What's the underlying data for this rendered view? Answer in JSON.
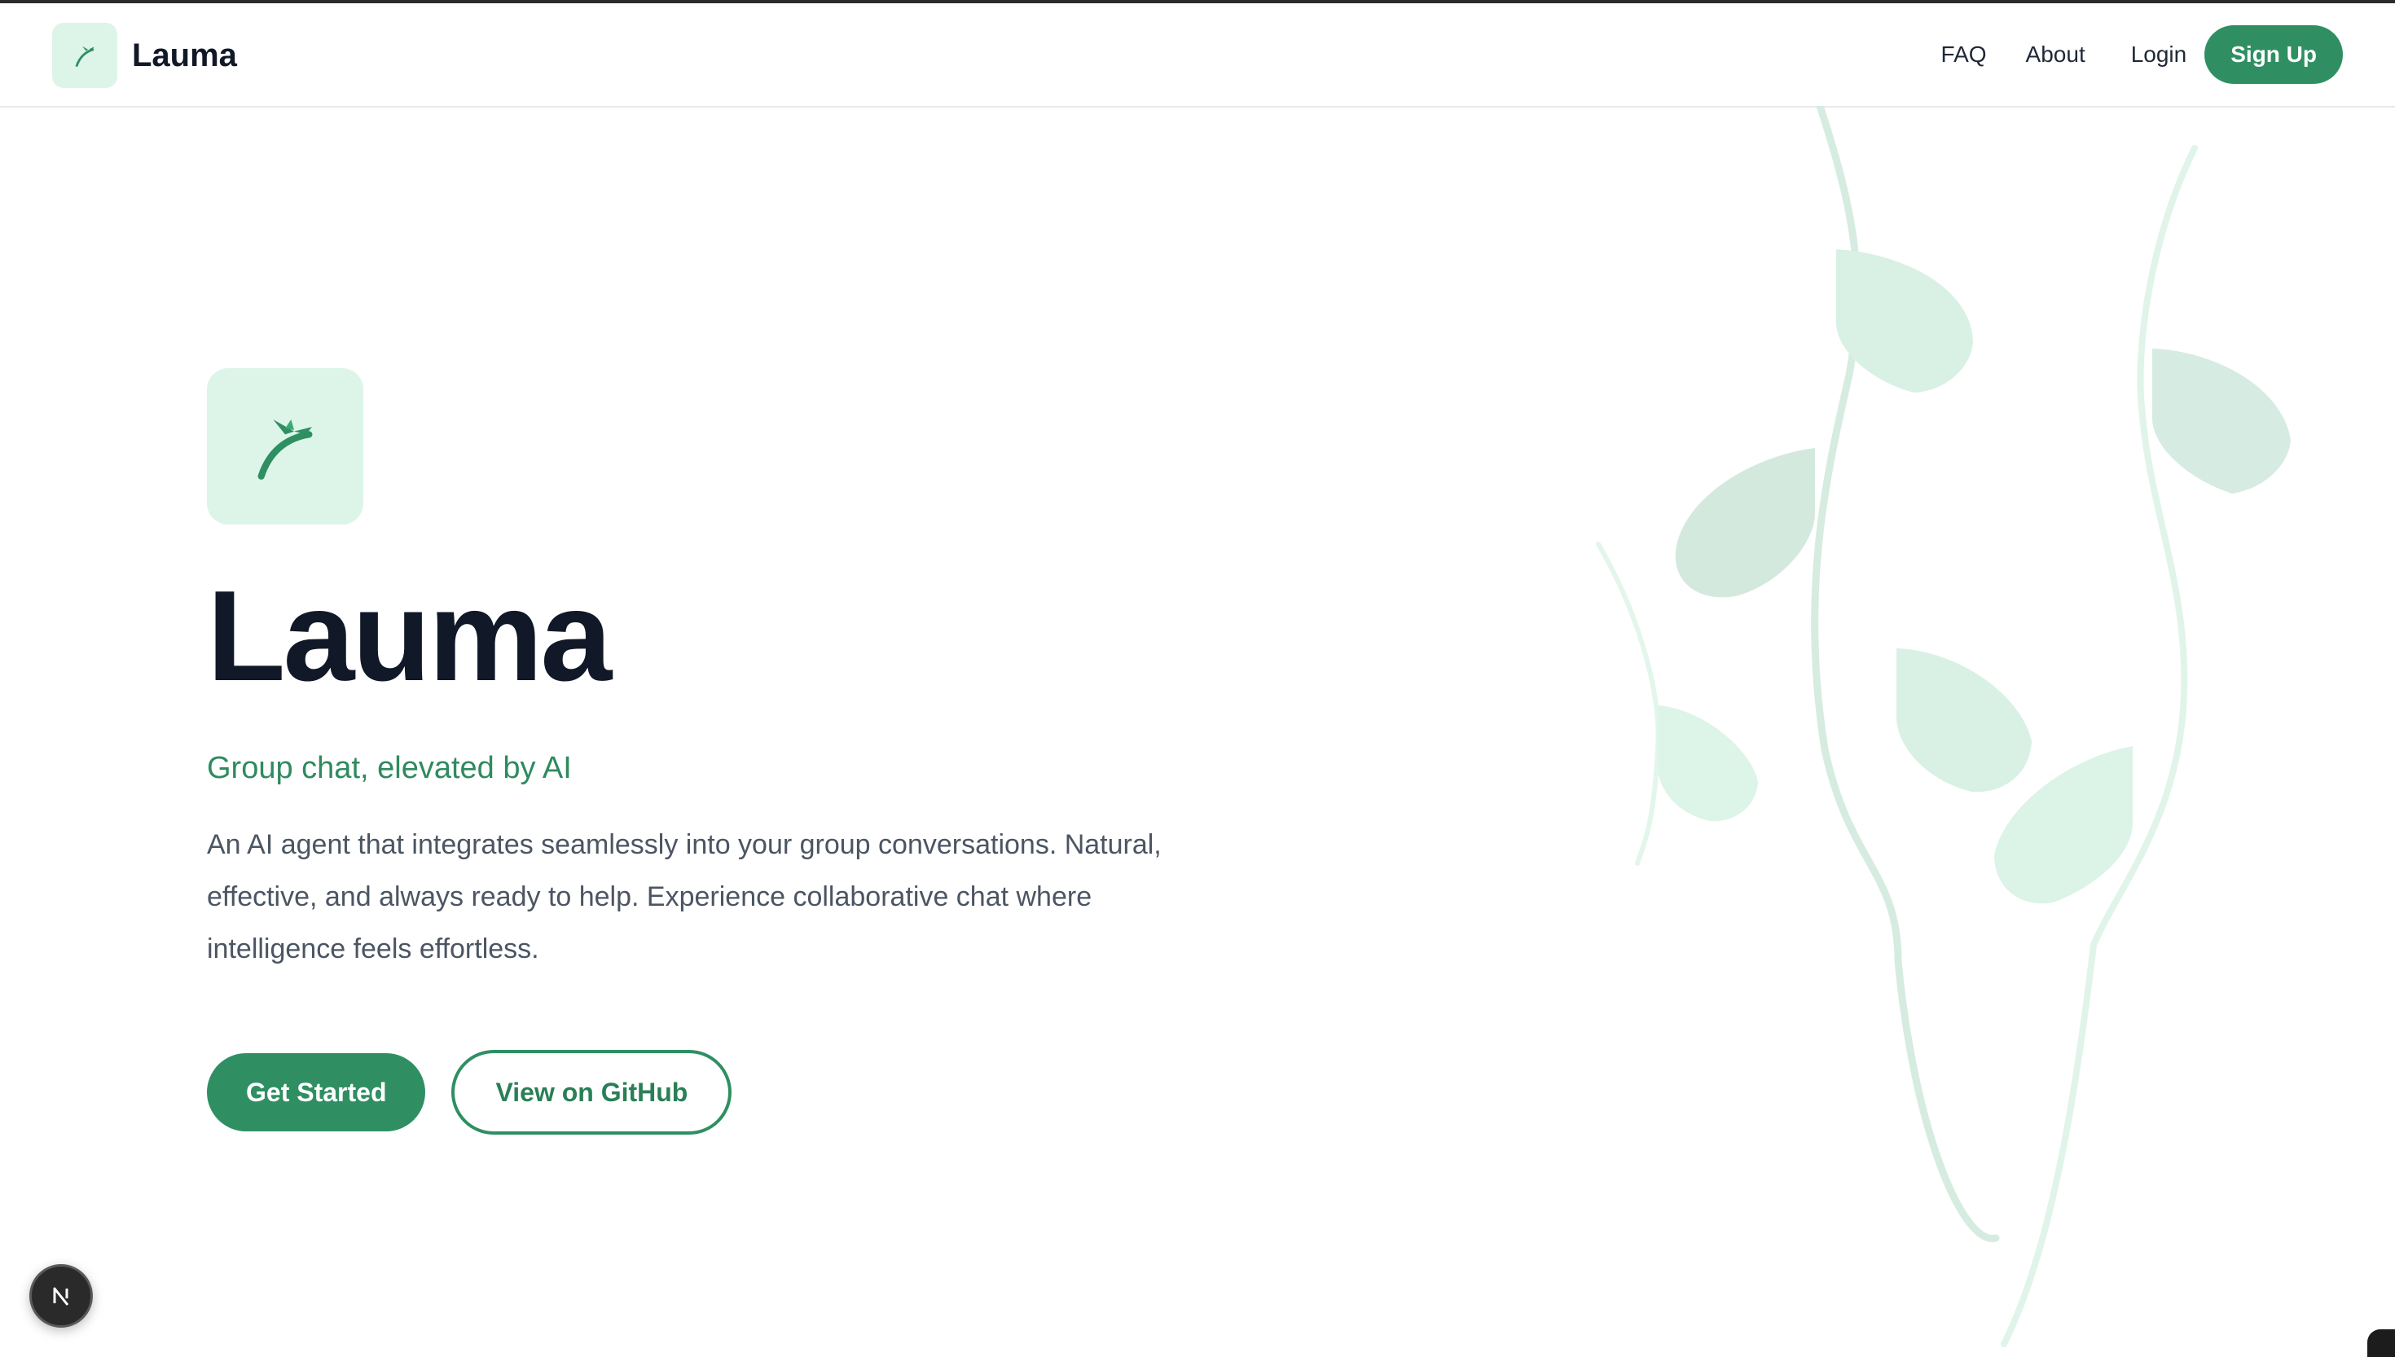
{
  "brand": {
    "name": "Lauma",
    "logo_icon": "bird-branch-icon"
  },
  "nav": {
    "faq": "FAQ",
    "about": "About",
    "login": "Login",
    "signup": "Sign Up"
  },
  "hero": {
    "logo_icon": "bird-branch-icon",
    "title": "Lauma",
    "tagline": "Group chat, elevated by AI",
    "description": "An AI agent that integrates seamlessly into your group conversations. Natural, effective, and always ready to help. Experience collaborative chat where intelligence feels effortless.",
    "primary_cta": "Get Started",
    "secondary_cta": "View on GitHub"
  },
  "dev_badge": {
    "icon": "nextjs-icon"
  },
  "colors": {
    "accent": "#2f8f63",
    "accent_text": "#2a7f57",
    "logo_bg": "#dcf5e8",
    "heading": "#111827",
    "body_text": "#4b5563",
    "leaf_decoration": "#d7eee2"
  }
}
